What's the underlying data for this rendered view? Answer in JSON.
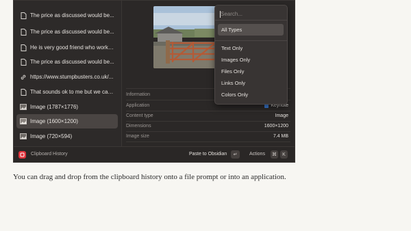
{
  "sidebar": {
    "items": [
      {
        "icon": "document-icon",
        "label": "The price as discussed would be..."
      },
      {
        "icon": "document-icon",
        "label": "The price as discussed would be..."
      },
      {
        "icon": "document-icon",
        "label": "He is very good friend who works..."
      },
      {
        "icon": "document-icon",
        "label": "The price as discussed would be..."
      },
      {
        "icon": "link-icon",
        "label": "https://www.stumpbusters.co.uk/..."
      },
      {
        "icon": "document-icon",
        "label": "That sounds ok to me but we can..."
      },
      {
        "icon": "image-icon",
        "label": "Image (1787×1776)"
      },
      {
        "icon": "image-icon",
        "label": "Image (1600×1200)",
        "selected": true
      },
      {
        "icon": "image-icon",
        "label": "Image (720×594)"
      }
    ]
  },
  "info": {
    "heading": "Information",
    "rows": [
      {
        "label": "Application",
        "value": "Keynote"
      },
      {
        "label": "Content type",
        "value": "Image"
      },
      {
        "label": "Dimensions",
        "value": "1600×1200"
      },
      {
        "label": "Image size",
        "value": "7.4 MB"
      }
    ]
  },
  "dropdown": {
    "placeholder": "Search...",
    "options": [
      "All Types",
      "Text Only",
      "Images Only",
      "Files Only",
      "Links Only",
      "Colors Only"
    ],
    "selected": "All Types"
  },
  "footer": {
    "app_name": "Clipboard History",
    "paste_label": "Paste to Obsidian",
    "paste_key": "↵",
    "actions_label": "Actions",
    "actions_key1": "⌘",
    "actions_key2": "K"
  },
  "caption": "You can drag and drop from the clipboard history onto a file prompt or into an application.",
  "colors": {
    "accent": "#e0333c",
    "keynote_icon": "#3a7bd5"
  }
}
